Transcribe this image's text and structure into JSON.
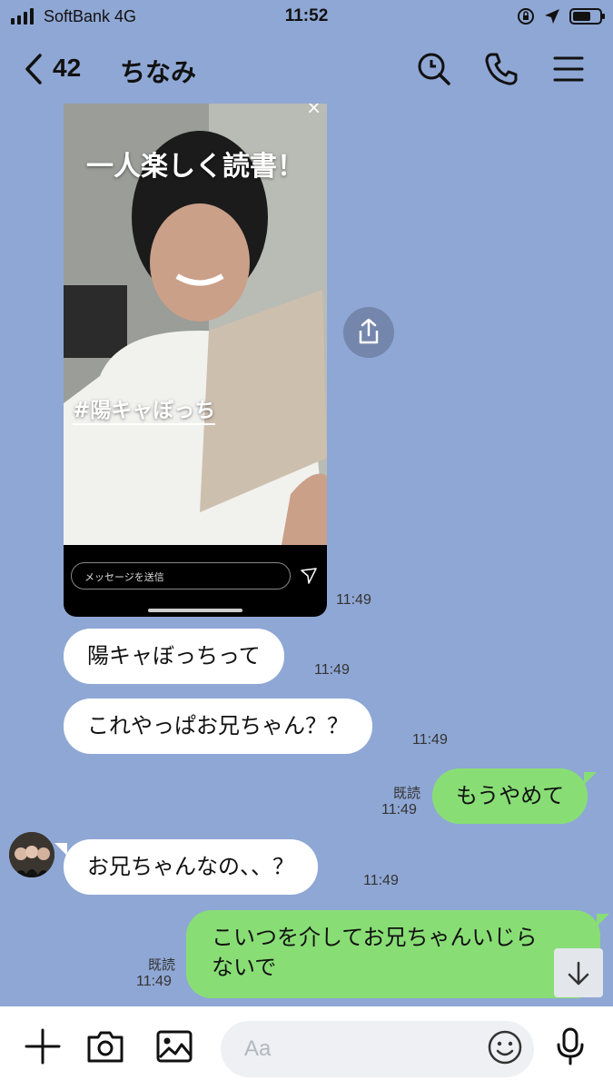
{
  "status_bar": {
    "carrier": "SoftBank  4G",
    "time": "11:52"
  },
  "header": {
    "back_count": "42",
    "title": "ちなみ"
  },
  "shared_image": {
    "caption": "一人楽しく読書！",
    "hashtag": "#陽キャぼっち",
    "reply_placeholder": "メッセージを送信",
    "time": "11:49"
  },
  "messages": [
    {
      "side": "in",
      "text": "陽キャぼっちって",
      "time": "11:49"
    },
    {
      "side": "in",
      "text": "これやっぱお兄ちゃん？？",
      "time": "11:49"
    },
    {
      "side": "out",
      "text": "もうやめて",
      "read": "既読",
      "time": "11:49"
    },
    {
      "side": "in",
      "text": "お兄ちゃんなの、、？",
      "time": "11:49"
    },
    {
      "side": "out",
      "text_line1": "こいつを介してお兄ちゃんいじら",
      "text_line2": "ないで",
      "read": "既読",
      "time": "11:49"
    }
  ],
  "composer": {
    "placeholder": "Aa"
  },
  "colors": {
    "background": "#8fa7d4",
    "outgoing_bubble": "#88de75",
    "incoming_bubble": "#ffffff"
  },
  "icons": [
    "signal-icon",
    "screen-lock-icon",
    "location-icon",
    "battery-icon",
    "back-chevron-icon",
    "search-icon",
    "phone-icon",
    "menu-icon",
    "share-icon",
    "send-icon",
    "arrow-down-icon",
    "plus-icon",
    "camera-icon",
    "image-icon",
    "emoji-icon",
    "microphone-icon"
  ]
}
